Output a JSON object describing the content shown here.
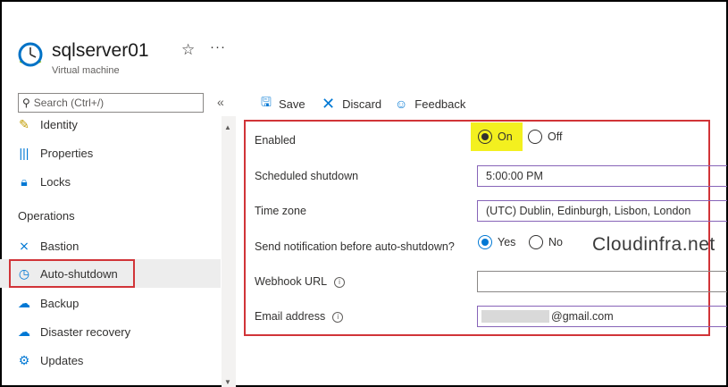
{
  "header": {
    "title": "sqlserver01",
    "subtitle": "Virtual machine",
    "icons": [
      "vm-clock-icon",
      "star-icon",
      "more-icon"
    ]
  },
  "sidebar": {
    "search_placeholder": "Search (Ctrl+/)",
    "collapse_glyph": "«",
    "items": [
      {
        "label": "Identity",
        "icon": "identity-icon"
      },
      {
        "label": "Properties",
        "icon": "properties-icon"
      },
      {
        "label": "Locks",
        "icon": "lock-icon"
      }
    ],
    "section": "Operations",
    "ops_items": [
      {
        "label": "Bastion",
        "icon": "bastion-icon"
      },
      {
        "label": "Auto-shutdown",
        "icon": "clock-icon",
        "selected": true
      },
      {
        "label": "Backup",
        "icon": "cloud-icon"
      },
      {
        "label": "Disaster recovery",
        "icon": "cloud-icon"
      },
      {
        "label": "Updates",
        "icon": "gear-icon"
      }
    ]
  },
  "toolbar": {
    "save": "Save",
    "discard": "Discard",
    "feedback": "Feedback"
  },
  "form": {
    "enabled_label": "Enabled",
    "enabled_on": "On",
    "enabled_off": "Off",
    "enabled_value": "On",
    "shutdown_label": "Scheduled shutdown",
    "shutdown_value": "5:00:00 PM",
    "timezone_label": "Time zone",
    "timezone_value": "(UTC) Dublin, Edinburgh, Lisbon, London",
    "notify_label": "Send notification before auto-shutdown?",
    "notify_yes": "Yes",
    "notify_no": "No",
    "notify_value": "Yes",
    "webhook_label": "Webhook URL",
    "webhook_value": "",
    "email_label": "Email address",
    "email_value": "@gmail.com"
  },
  "watermark": "Cloudinfra.net",
  "colors": {
    "accent": "#0078d4",
    "annotation_red": "#d13438",
    "highlight_yellow": "#f3f01f",
    "selected_bg": "#ededed"
  }
}
